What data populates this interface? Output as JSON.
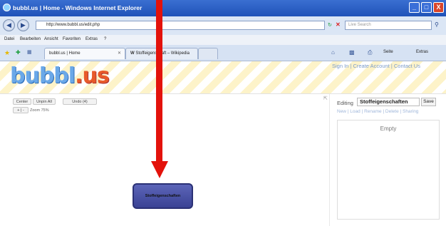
{
  "window": {
    "title": "bubbl.us | Home - Windows Internet Explorer",
    "buttons": [
      "_",
      "□",
      "X"
    ]
  },
  "address": {
    "url": "http://www.bubbl.us/edit.php",
    "search_placeholder": "Live Search"
  },
  "menu": [
    "Datei",
    "Bearbeiten",
    "Ansicht",
    "Favoriten",
    "Extras",
    "?"
  ],
  "tabs": [
    {
      "label": "bubbl.us | Home"
    },
    {
      "label": "Stoffeigenschaft – Wikipedia"
    }
  ],
  "ie_toolbar": {
    "seite": "Seite",
    "extras": "Extras"
  },
  "site": {
    "logo_main": "bubbl",
    "logo_suffix": ".us",
    "links": "Sign In | Create Account | Contact Us"
  },
  "canvas": {
    "center": "Center",
    "unpin_all": "Unpin All",
    "undo": "Undo (4)",
    "zoom": "Zoom 75%",
    "bubble_text": "Stoffeigenschaften"
  },
  "panel": {
    "editing_label": "Editing",
    "editing_value": "Stoffeigenschaften",
    "save": "Save",
    "actions": "New | Load | Rename | Delete | Sharing",
    "empty": "Empty"
  },
  "colors": {
    "arrow": "#e3120b",
    "bubble": "#3f479a",
    "titlebar": "#2a5cc4"
  }
}
